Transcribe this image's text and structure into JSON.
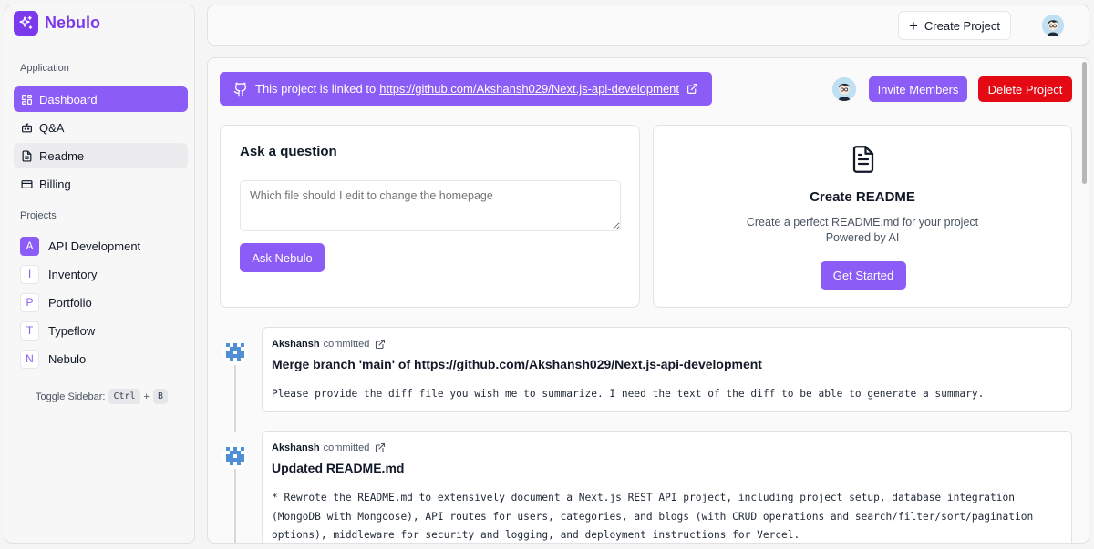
{
  "app": {
    "name": "Nebulo",
    "brand_color": "#7c3aed",
    "accent": "#8b5cf6",
    "danger": "#e50914"
  },
  "sidebar": {
    "application_label": "Application",
    "items": [
      {
        "label": "Dashboard",
        "icon": "dashboard-icon"
      },
      {
        "label": "Q&A",
        "icon": "bot-icon"
      },
      {
        "label": "Readme",
        "icon": "file-text-icon"
      },
      {
        "label": "Billing",
        "icon": "credit-card-icon"
      }
    ],
    "projects_label": "Projects",
    "projects": [
      {
        "initial": "A",
        "name": "API Development"
      },
      {
        "initial": "I",
        "name": "Inventory"
      },
      {
        "initial": "P",
        "name": "Portfolio"
      },
      {
        "initial": "T",
        "name": "Typeflow"
      },
      {
        "initial": "N",
        "name": "Nebulo"
      }
    ],
    "toggle_hint": {
      "label": "Toggle Sidebar:",
      "key1": "Ctrl",
      "plus": "+",
      "key2": "B"
    }
  },
  "topbar": {
    "create_label": "Create Project"
  },
  "banner": {
    "prefix": "This project is linked to",
    "url": "https://github.com/Akshansh029/Next.js-api-development"
  },
  "actions": {
    "invite_label": "Invite Members",
    "delete_label": "Delete Project"
  },
  "ask": {
    "title": "Ask a question",
    "placeholder": "Which file should I edit to change the homepage",
    "button": "Ask Nebulo"
  },
  "readme": {
    "title": "Create README",
    "line1": "Create a perfect README.md for your project",
    "line2": "Powered by AI",
    "button": "Get Started"
  },
  "commits": [
    {
      "author": "Akshansh",
      "action": "committed",
      "title": "Merge branch 'main' of https://github.com/Akshansh029/Next.js-api-development",
      "summary": "Please provide the diff file you wish me to summarize. I need the text of the diff to be able to generate a summary."
    },
    {
      "author": "Akshansh",
      "action": "committed",
      "title": "Updated README.md",
      "summary": "* Rewrote the README.md to extensively document a Next.js REST API project, including project setup, database integration (MongoDB with Mongoose), API routes for users, categories, and blogs (with CRUD operations and search/filter/sort/pagination options), middleware for security and logging, and deployment instructions for Vercel."
    }
  ]
}
